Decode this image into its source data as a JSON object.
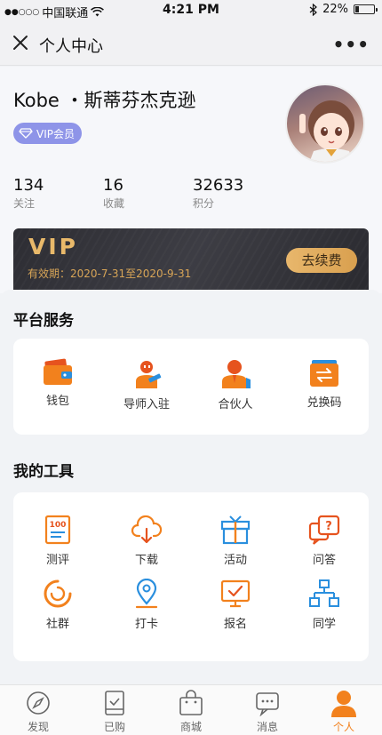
{
  "status_bar": {
    "carrier": "中国联通",
    "time": "4:21 PM",
    "battery": "22%",
    "battery_level": 0.22
  },
  "navbar": {
    "title": "个人中心"
  },
  "profile": {
    "name": "Kobe ・斯蒂芬杰克逊",
    "vip_badge": "VIP会员",
    "stats": [
      {
        "value": "134",
        "label": "关注"
      },
      {
        "value": "16",
        "label": "收藏"
      },
      {
        "value": "32633",
        "label": "积分"
      }
    ]
  },
  "vip_card": {
    "title": "VIP",
    "validity": "有效期：2020-7-31至2020-9-31",
    "renew_label": "去续费"
  },
  "platform_services": {
    "title": "平台服务",
    "items": [
      {
        "label": "钱包",
        "icon": "wallet-icon"
      },
      {
        "label": "导师入驻",
        "icon": "mentor-icon"
      },
      {
        "label": "合伙人",
        "icon": "partner-icon"
      },
      {
        "label": "兑换码",
        "icon": "exchange-code-icon"
      }
    ]
  },
  "my_tools": {
    "title": "我的工具",
    "items": [
      {
        "label": "测评",
        "icon": "assessment-icon"
      },
      {
        "label": "下载",
        "icon": "download-icon"
      },
      {
        "label": "活动",
        "icon": "gift-icon"
      },
      {
        "label": "问答",
        "icon": "qa-icon"
      },
      {
        "label": "社群",
        "icon": "community-icon"
      },
      {
        "label": "打卡",
        "icon": "location-pin-icon"
      },
      {
        "label": "报名",
        "icon": "signup-icon"
      },
      {
        "label": "同学",
        "icon": "classmates-icon"
      }
    ]
  },
  "tabbar": {
    "items": [
      {
        "label": "发现",
        "icon": "compass-icon"
      },
      {
        "label": "已购",
        "icon": "purchased-icon"
      },
      {
        "label": "商城",
        "icon": "shopping-bag-icon"
      },
      {
        "label": "消息",
        "icon": "message-icon"
      },
      {
        "label": "个人",
        "icon": "person-icon"
      }
    ],
    "active_index": 4
  },
  "colors": {
    "accent_orange": "#f2811d",
    "vip_purple": "#8e94e8",
    "vip_gold": "#e9b96a",
    "blue_icon": "#2a8fde"
  }
}
